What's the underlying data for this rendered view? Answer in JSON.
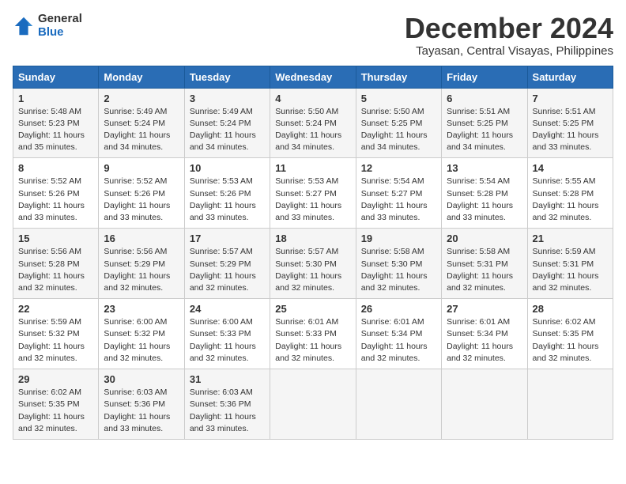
{
  "logo": {
    "general": "General",
    "blue": "Blue"
  },
  "title": "December 2024",
  "location": "Tayasan, Central Visayas, Philippines",
  "days_of_week": [
    "Sunday",
    "Monday",
    "Tuesday",
    "Wednesday",
    "Thursday",
    "Friday",
    "Saturday"
  ],
  "weeks": [
    [
      {
        "day": "1",
        "sunrise": "5:48 AM",
        "sunset": "5:23 PM",
        "daylight": "11 hours and 35 minutes."
      },
      {
        "day": "2",
        "sunrise": "5:49 AM",
        "sunset": "5:24 PM",
        "daylight": "11 hours and 34 minutes."
      },
      {
        "day": "3",
        "sunrise": "5:49 AM",
        "sunset": "5:24 PM",
        "daylight": "11 hours and 34 minutes."
      },
      {
        "day": "4",
        "sunrise": "5:50 AM",
        "sunset": "5:24 PM",
        "daylight": "11 hours and 34 minutes."
      },
      {
        "day": "5",
        "sunrise": "5:50 AM",
        "sunset": "5:25 PM",
        "daylight": "11 hours and 34 minutes."
      },
      {
        "day": "6",
        "sunrise": "5:51 AM",
        "sunset": "5:25 PM",
        "daylight": "11 hours and 34 minutes."
      },
      {
        "day": "7",
        "sunrise": "5:51 AM",
        "sunset": "5:25 PM",
        "daylight": "11 hours and 33 minutes."
      }
    ],
    [
      {
        "day": "8",
        "sunrise": "5:52 AM",
        "sunset": "5:26 PM",
        "daylight": "11 hours and 33 minutes."
      },
      {
        "day": "9",
        "sunrise": "5:52 AM",
        "sunset": "5:26 PM",
        "daylight": "11 hours and 33 minutes."
      },
      {
        "day": "10",
        "sunrise": "5:53 AM",
        "sunset": "5:26 PM",
        "daylight": "11 hours and 33 minutes."
      },
      {
        "day": "11",
        "sunrise": "5:53 AM",
        "sunset": "5:27 PM",
        "daylight": "11 hours and 33 minutes."
      },
      {
        "day": "12",
        "sunrise": "5:54 AM",
        "sunset": "5:27 PM",
        "daylight": "11 hours and 33 minutes."
      },
      {
        "day": "13",
        "sunrise": "5:54 AM",
        "sunset": "5:28 PM",
        "daylight": "11 hours and 33 minutes."
      },
      {
        "day": "14",
        "sunrise": "5:55 AM",
        "sunset": "5:28 PM",
        "daylight": "11 hours and 32 minutes."
      }
    ],
    [
      {
        "day": "15",
        "sunrise": "5:56 AM",
        "sunset": "5:28 PM",
        "daylight": "11 hours and 32 minutes."
      },
      {
        "day": "16",
        "sunrise": "5:56 AM",
        "sunset": "5:29 PM",
        "daylight": "11 hours and 32 minutes."
      },
      {
        "day": "17",
        "sunrise": "5:57 AM",
        "sunset": "5:29 PM",
        "daylight": "11 hours and 32 minutes."
      },
      {
        "day": "18",
        "sunrise": "5:57 AM",
        "sunset": "5:30 PM",
        "daylight": "11 hours and 32 minutes."
      },
      {
        "day": "19",
        "sunrise": "5:58 AM",
        "sunset": "5:30 PM",
        "daylight": "11 hours and 32 minutes."
      },
      {
        "day": "20",
        "sunrise": "5:58 AM",
        "sunset": "5:31 PM",
        "daylight": "11 hours and 32 minutes."
      },
      {
        "day": "21",
        "sunrise": "5:59 AM",
        "sunset": "5:31 PM",
        "daylight": "11 hours and 32 minutes."
      }
    ],
    [
      {
        "day": "22",
        "sunrise": "5:59 AM",
        "sunset": "5:32 PM",
        "daylight": "11 hours and 32 minutes."
      },
      {
        "day": "23",
        "sunrise": "6:00 AM",
        "sunset": "5:32 PM",
        "daylight": "11 hours and 32 minutes."
      },
      {
        "day": "24",
        "sunrise": "6:00 AM",
        "sunset": "5:33 PM",
        "daylight": "11 hours and 32 minutes."
      },
      {
        "day": "25",
        "sunrise": "6:01 AM",
        "sunset": "5:33 PM",
        "daylight": "11 hours and 32 minutes."
      },
      {
        "day": "26",
        "sunrise": "6:01 AM",
        "sunset": "5:34 PM",
        "daylight": "11 hours and 32 minutes."
      },
      {
        "day": "27",
        "sunrise": "6:01 AM",
        "sunset": "5:34 PM",
        "daylight": "11 hours and 32 minutes."
      },
      {
        "day": "28",
        "sunrise": "6:02 AM",
        "sunset": "5:35 PM",
        "daylight": "11 hours and 32 minutes."
      }
    ],
    [
      {
        "day": "29",
        "sunrise": "6:02 AM",
        "sunset": "5:35 PM",
        "daylight": "11 hours and 32 minutes."
      },
      {
        "day": "30",
        "sunrise": "6:03 AM",
        "sunset": "5:36 PM",
        "daylight": "11 hours and 33 minutes."
      },
      {
        "day": "31",
        "sunrise": "6:03 AM",
        "sunset": "5:36 PM",
        "daylight": "11 hours and 33 minutes."
      },
      null,
      null,
      null,
      null
    ]
  ],
  "labels": {
    "sunrise": "Sunrise:",
    "sunset": "Sunset:",
    "daylight": "Daylight:"
  }
}
